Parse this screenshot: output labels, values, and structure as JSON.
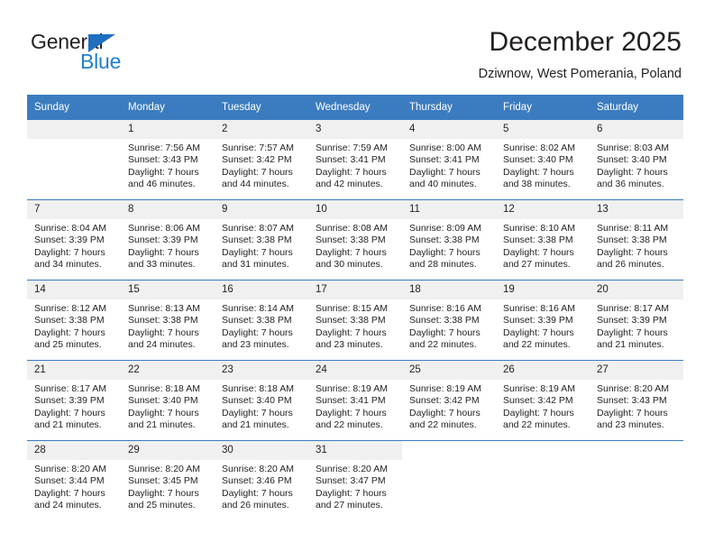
{
  "brand": {
    "name_top": "General",
    "name_bottom": "Blue",
    "triangle_color": "#1f6fc0",
    "blue_color": "#1f7fd0"
  },
  "header": {
    "title": "December 2025",
    "location": "Dziwnow, West Pomerania, Poland"
  },
  "theme": {
    "header_row_bg": "#3b7cc0",
    "header_row_text": "#ffffff",
    "daynum_bg": "#f0f0f0",
    "grid_line": "#3b7cc0",
    "text": "#231f20"
  },
  "weekday_headers": [
    "Sunday",
    "Monday",
    "Tuesday",
    "Wednesday",
    "Thursday",
    "Friday",
    "Saturday"
  ],
  "weeks": [
    [
      {
        "day": "",
        "sunrise": "",
        "sunset": "",
        "daylight_line1": "",
        "daylight_line2": "",
        "empty": true,
        "shaded": true
      },
      {
        "day": "1",
        "sunrise": "Sunrise: 7:56 AM",
        "sunset": "Sunset: 3:43 PM",
        "daylight_line1": "Daylight: 7 hours",
        "daylight_line2": "and 46 minutes."
      },
      {
        "day": "2",
        "sunrise": "Sunrise: 7:57 AM",
        "sunset": "Sunset: 3:42 PM",
        "daylight_line1": "Daylight: 7 hours",
        "daylight_line2": "and 44 minutes."
      },
      {
        "day": "3",
        "sunrise": "Sunrise: 7:59 AM",
        "sunset": "Sunset: 3:41 PM",
        "daylight_line1": "Daylight: 7 hours",
        "daylight_line2": "and 42 minutes."
      },
      {
        "day": "4",
        "sunrise": "Sunrise: 8:00 AM",
        "sunset": "Sunset: 3:41 PM",
        "daylight_line1": "Daylight: 7 hours",
        "daylight_line2": "and 40 minutes."
      },
      {
        "day": "5",
        "sunrise": "Sunrise: 8:02 AM",
        "sunset": "Sunset: 3:40 PM",
        "daylight_line1": "Daylight: 7 hours",
        "daylight_line2": "and 38 minutes."
      },
      {
        "day": "6",
        "sunrise": "Sunrise: 8:03 AM",
        "sunset": "Sunset: 3:40 PM",
        "daylight_line1": "Daylight: 7 hours",
        "daylight_line2": "and 36 minutes."
      }
    ],
    [
      {
        "day": "7",
        "sunrise": "Sunrise: 8:04 AM",
        "sunset": "Sunset: 3:39 PM",
        "daylight_line1": "Daylight: 7 hours",
        "daylight_line2": "and 34 minutes."
      },
      {
        "day": "8",
        "sunrise": "Sunrise: 8:06 AM",
        "sunset": "Sunset: 3:39 PM",
        "daylight_line1": "Daylight: 7 hours",
        "daylight_line2": "and 33 minutes."
      },
      {
        "day": "9",
        "sunrise": "Sunrise: 8:07 AM",
        "sunset": "Sunset: 3:38 PM",
        "daylight_line1": "Daylight: 7 hours",
        "daylight_line2": "and 31 minutes."
      },
      {
        "day": "10",
        "sunrise": "Sunrise: 8:08 AM",
        "sunset": "Sunset: 3:38 PM",
        "daylight_line1": "Daylight: 7 hours",
        "daylight_line2": "and 30 minutes."
      },
      {
        "day": "11",
        "sunrise": "Sunrise: 8:09 AM",
        "sunset": "Sunset: 3:38 PM",
        "daylight_line1": "Daylight: 7 hours",
        "daylight_line2": "and 28 minutes."
      },
      {
        "day": "12",
        "sunrise": "Sunrise: 8:10 AM",
        "sunset": "Sunset: 3:38 PM",
        "daylight_line1": "Daylight: 7 hours",
        "daylight_line2": "and 27 minutes."
      },
      {
        "day": "13",
        "sunrise": "Sunrise: 8:11 AM",
        "sunset": "Sunset: 3:38 PM",
        "daylight_line1": "Daylight: 7 hours",
        "daylight_line2": "and 26 minutes."
      }
    ],
    [
      {
        "day": "14",
        "sunrise": "Sunrise: 8:12 AM",
        "sunset": "Sunset: 3:38 PM",
        "daylight_line1": "Daylight: 7 hours",
        "daylight_line2": "and 25 minutes."
      },
      {
        "day": "15",
        "sunrise": "Sunrise: 8:13 AM",
        "sunset": "Sunset: 3:38 PM",
        "daylight_line1": "Daylight: 7 hours",
        "daylight_line2": "and 24 minutes."
      },
      {
        "day": "16",
        "sunrise": "Sunrise: 8:14 AM",
        "sunset": "Sunset: 3:38 PM",
        "daylight_line1": "Daylight: 7 hours",
        "daylight_line2": "and 23 minutes."
      },
      {
        "day": "17",
        "sunrise": "Sunrise: 8:15 AM",
        "sunset": "Sunset: 3:38 PM",
        "daylight_line1": "Daylight: 7 hours",
        "daylight_line2": "and 23 minutes."
      },
      {
        "day": "18",
        "sunrise": "Sunrise: 8:16 AM",
        "sunset": "Sunset: 3:38 PM",
        "daylight_line1": "Daylight: 7 hours",
        "daylight_line2": "and 22 minutes."
      },
      {
        "day": "19",
        "sunrise": "Sunrise: 8:16 AM",
        "sunset": "Sunset: 3:39 PM",
        "daylight_line1": "Daylight: 7 hours",
        "daylight_line2": "and 22 minutes."
      },
      {
        "day": "20",
        "sunrise": "Sunrise: 8:17 AM",
        "sunset": "Sunset: 3:39 PM",
        "daylight_line1": "Daylight: 7 hours",
        "daylight_line2": "and 21 minutes."
      }
    ],
    [
      {
        "day": "21",
        "sunrise": "Sunrise: 8:17 AM",
        "sunset": "Sunset: 3:39 PM",
        "daylight_line1": "Daylight: 7 hours",
        "daylight_line2": "and 21 minutes."
      },
      {
        "day": "22",
        "sunrise": "Sunrise: 8:18 AM",
        "sunset": "Sunset: 3:40 PM",
        "daylight_line1": "Daylight: 7 hours",
        "daylight_line2": "and 21 minutes."
      },
      {
        "day": "23",
        "sunrise": "Sunrise: 8:18 AM",
        "sunset": "Sunset: 3:40 PM",
        "daylight_line1": "Daylight: 7 hours",
        "daylight_line2": "and 21 minutes."
      },
      {
        "day": "24",
        "sunrise": "Sunrise: 8:19 AM",
        "sunset": "Sunset: 3:41 PM",
        "daylight_line1": "Daylight: 7 hours",
        "daylight_line2": "and 22 minutes."
      },
      {
        "day": "25",
        "sunrise": "Sunrise: 8:19 AM",
        "sunset": "Sunset: 3:42 PM",
        "daylight_line1": "Daylight: 7 hours",
        "daylight_line2": "and 22 minutes."
      },
      {
        "day": "26",
        "sunrise": "Sunrise: 8:19 AM",
        "sunset": "Sunset: 3:42 PM",
        "daylight_line1": "Daylight: 7 hours",
        "daylight_line2": "and 22 minutes."
      },
      {
        "day": "27",
        "sunrise": "Sunrise: 8:20 AM",
        "sunset": "Sunset: 3:43 PM",
        "daylight_line1": "Daylight: 7 hours",
        "daylight_line2": "and 23 minutes."
      }
    ],
    [
      {
        "day": "28",
        "sunrise": "Sunrise: 8:20 AM",
        "sunset": "Sunset: 3:44 PM",
        "daylight_line1": "Daylight: 7 hours",
        "daylight_line2": "and 24 minutes."
      },
      {
        "day": "29",
        "sunrise": "Sunrise: 8:20 AM",
        "sunset": "Sunset: 3:45 PM",
        "daylight_line1": "Daylight: 7 hours",
        "daylight_line2": "and 25 minutes."
      },
      {
        "day": "30",
        "sunrise": "Sunrise: 8:20 AM",
        "sunset": "Sunset: 3:46 PM",
        "daylight_line1": "Daylight: 7 hours",
        "daylight_line2": "and 26 minutes."
      },
      {
        "day": "31",
        "sunrise": "Sunrise: 8:20 AM",
        "sunset": "Sunset: 3:47 PM",
        "daylight_line1": "Daylight: 7 hours",
        "daylight_line2": "and 27 minutes."
      },
      {
        "day": "",
        "sunrise": "",
        "sunset": "",
        "daylight_line1": "",
        "daylight_line2": "",
        "empty": true,
        "blank": true
      },
      {
        "day": "",
        "sunrise": "",
        "sunset": "",
        "daylight_line1": "",
        "daylight_line2": "",
        "empty": true,
        "blank": true
      },
      {
        "day": "",
        "sunrise": "",
        "sunset": "",
        "daylight_line1": "",
        "daylight_line2": "",
        "empty": true,
        "blank": true
      }
    ]
  ]
}
